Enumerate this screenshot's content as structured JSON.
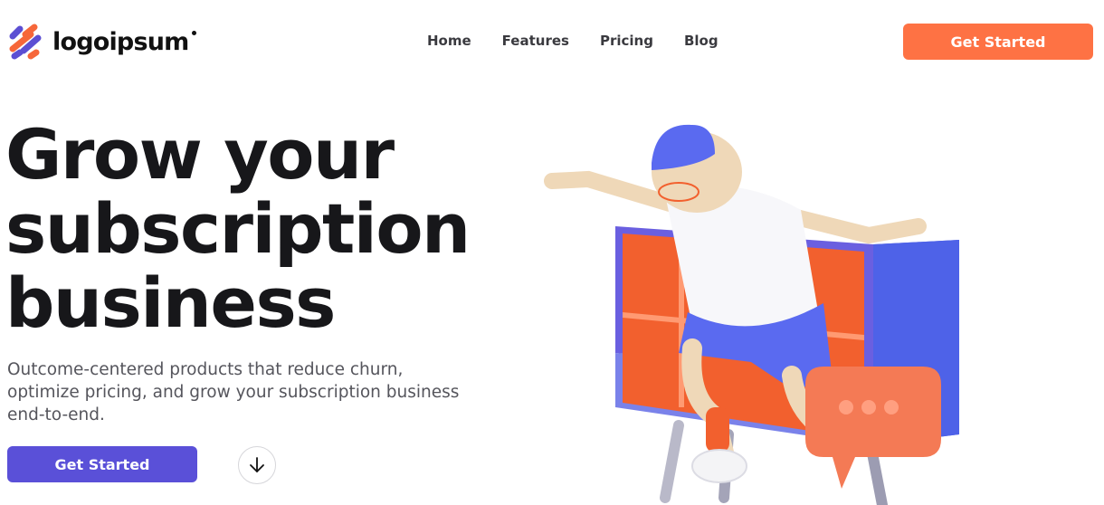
{
  "header": {
    "logo_text": "logoipsum",
    "nav": [
      {
        "label": "Home"
      },
      {
        "label": "Features"
      },
      {
        "label": "Pricing"
      },
      {
        "label": "Blog"
      }
    ],
    "cta_label": "Get Started"
  },
  "hero": {
    "title_lines": [
      "Grow your",
      "subscription",
      "business"
    ],
    "subtitle": "Outcome-centered products that reduce churn, optimize pricing, and grow your subscription business end-to-end.",
    "cta_label": "Get Started",
    "scroll_icon": "arrow-down-icon"
  },
  "colors": {
    "accent_orange": "#fe7244",
    "accent_purple": "#5a50d8",
    "logo_orange": "#f6673a",
    "logo_purple": "#5c4fd3",
    "illustration_blue": "#4f63e8",
    "illustration_orange": "#f2602e"
  }
}
